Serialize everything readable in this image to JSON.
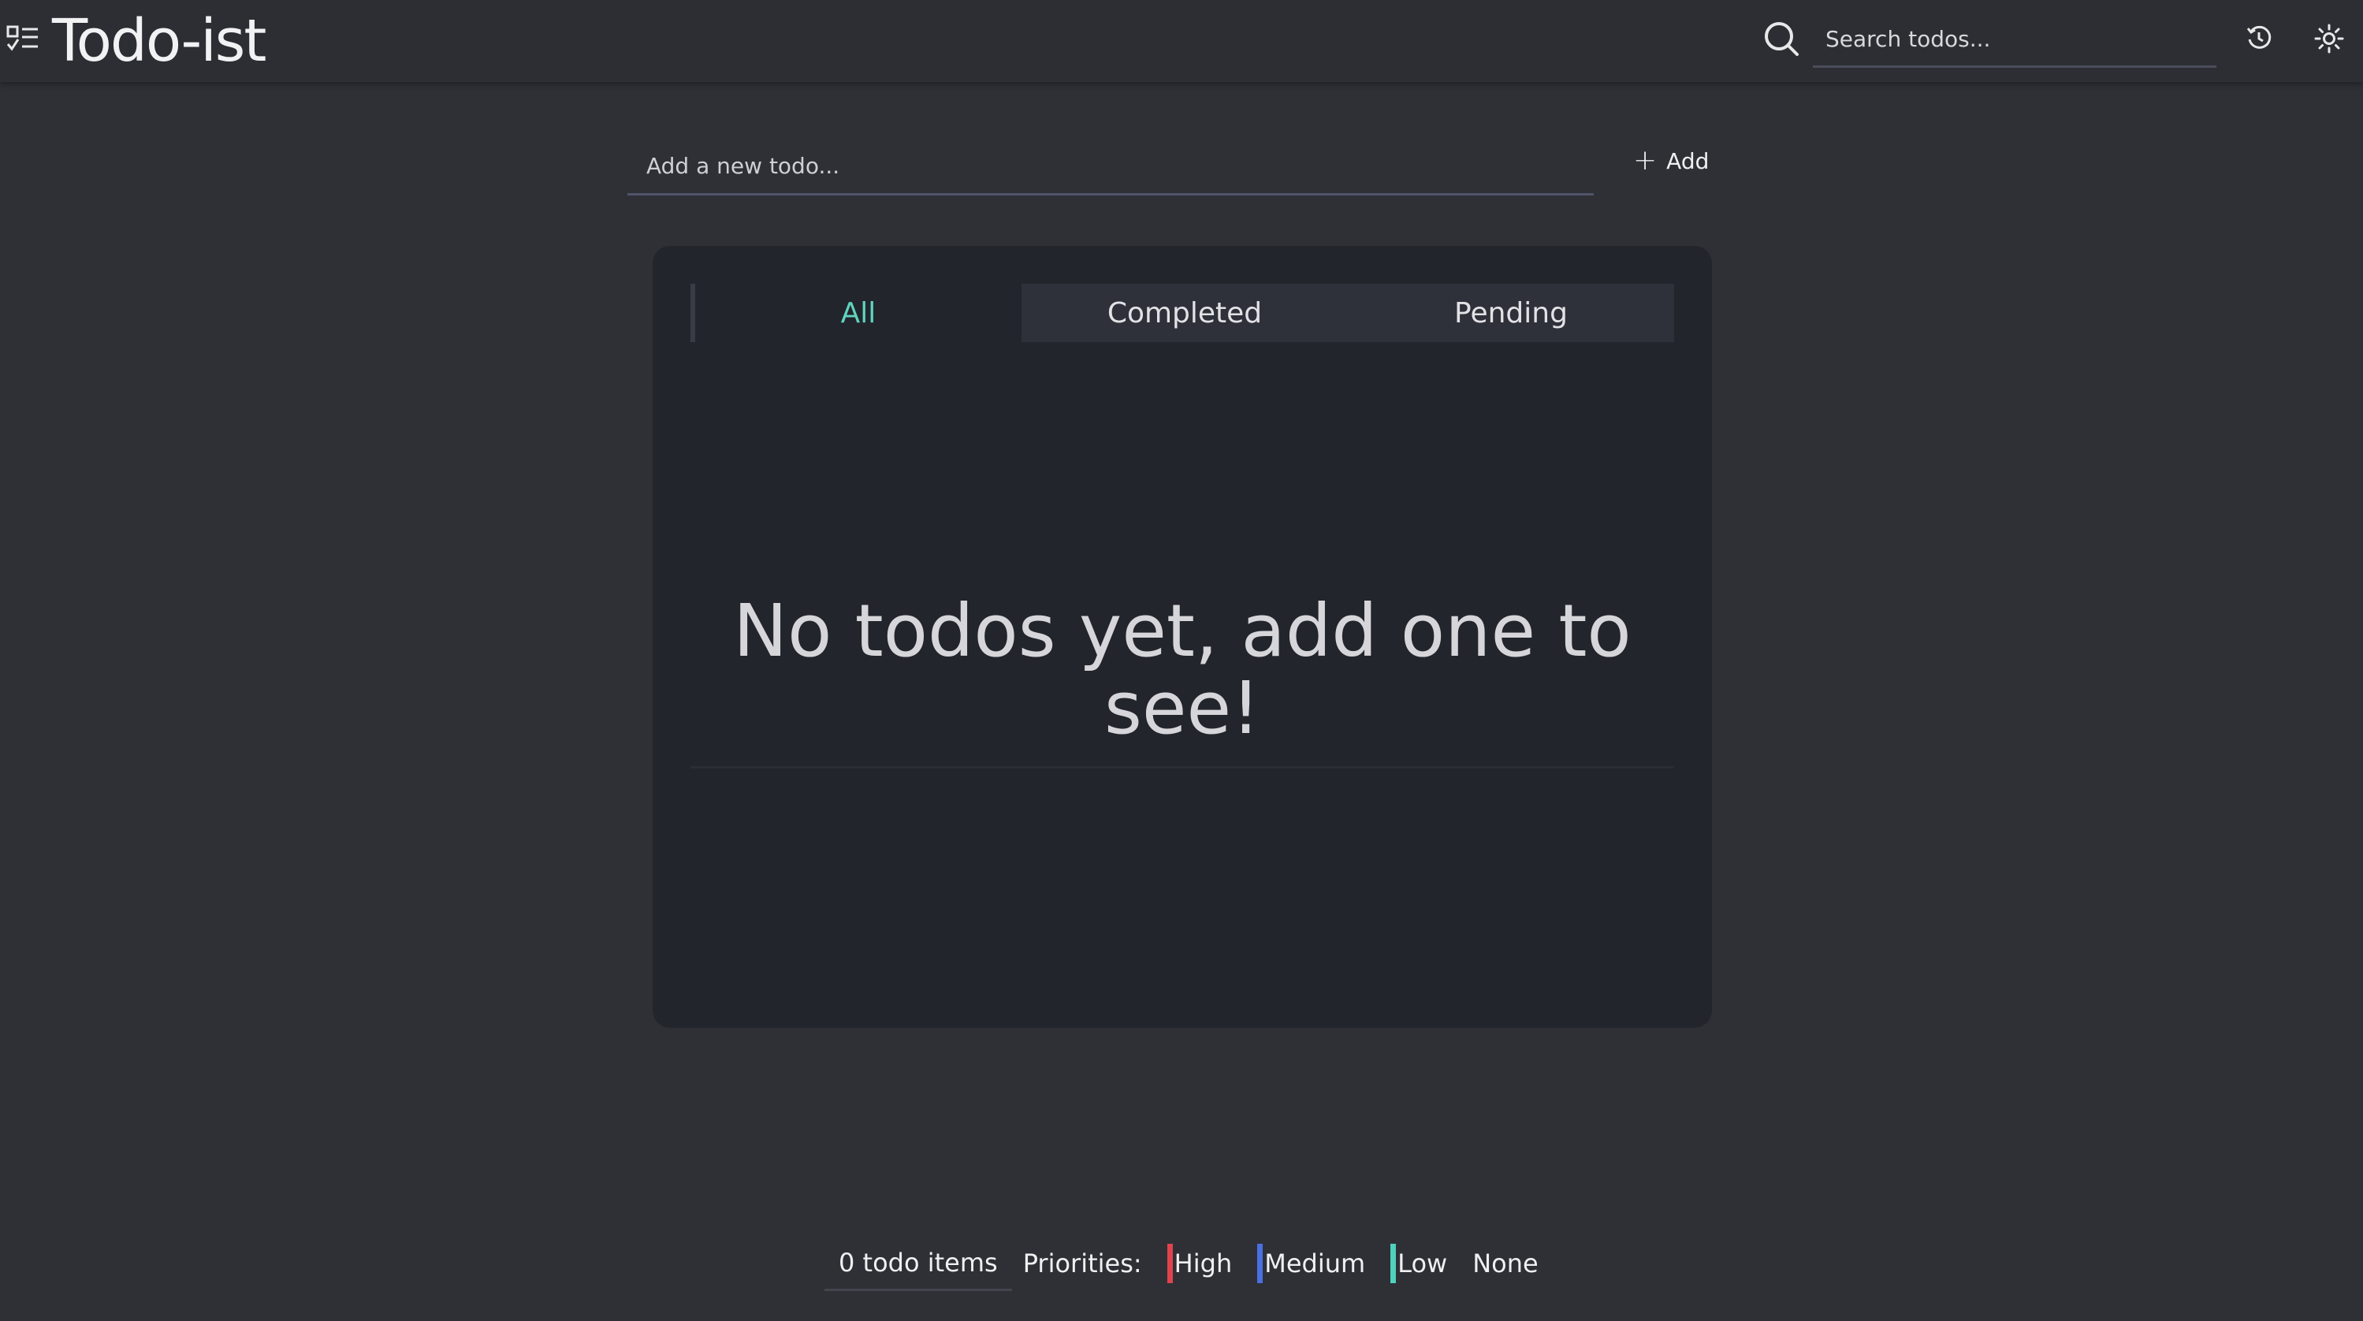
{
  "header": {
    "title": "Todo-ist",
    "search_placeholder": "Search todos...",
    "icons": [
      "checklist-menu-icon",
      "search-icon",
      "history-icon",
      "theme-toggle-icon"
    ]
  },
  "add": {
    "placeholder": "Add a new todo...",
    "button_label": "Add",
    "plus_glyph": "+"
  },
  "tabs": [
    {
      "label": "All",
      "active": true
    },
    {
      "label": "Completed",
      "active": false
    },
    {
      "label": "Pending",
      "active": false
    }
  ],
  "main": {
    "empty_message": "No todos yet, add one to see!"
  },
  "footer": {
    "count": "0 todo items",
    "priorities_label": "Priorities:",
    "priorities": [
      {
        "label": "High",
        "color": "#e0434e"
      },
      {
        "label": "Medium",
        "color": "#4a6fe0"
      },
      {
        "label": "Low",
        "color": "#4fd1bd"
      },
      {
        "label": "None",
        "color": ""
      }
    ]
  },
  "colors": {
    "background": "#2f3036",
    "card": "#23252c",
    "accent": "#5fd4be"
  }
}
